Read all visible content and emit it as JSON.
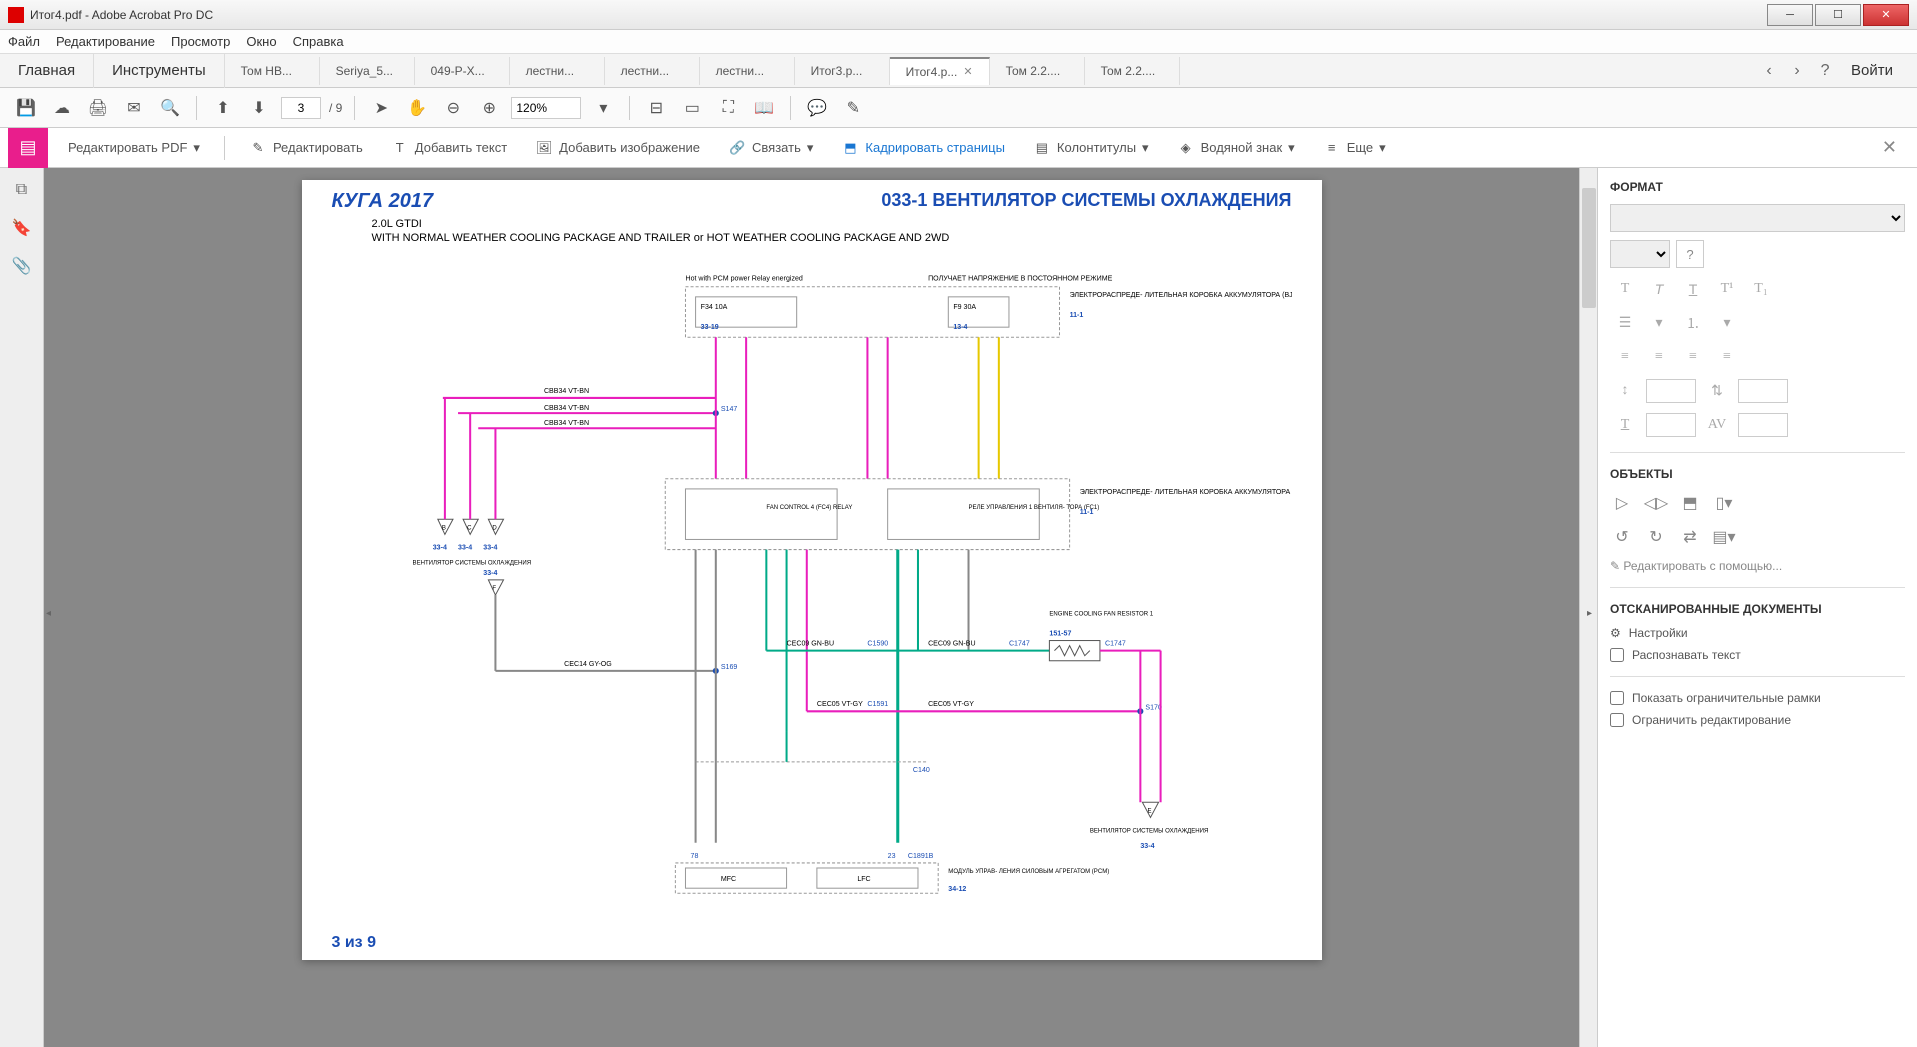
{
  "titlebar": {
    "text": "Итог4.pdf - Adobe Acrobat Pro DC"
  },
  "menu": {
    "items": [
      "Файл",
      "Редактирование",
      "Просмотр",
      "Окно",
      "Справка"
    ]
  },
  "nav": {
    "main": "Главная",
    "tools": "Инструменты",
    "login": "Войти"
  },
  "tabs": [
    {
      "label": "Том НВ..."
    },
    {
      "label": "Seriya_5..."
    },
    {
      "label": "049-Р-Х..."
    },
    {
      "label": "лестни..."
    },
    {
      "label": "лестни..."
    },
    {
      "label": "лестни..."
    },
    {
      "label": "Итог3.р..."
    },
    {
      "label": "Итог4.р...",
      "active": true
    },
    {
      "label": "Том 2.2...."
    },
    {
      "label": "Том 2.2...."
    }
  ],
  "toolbar": {
    "page_current": "3",
    "page_total": "/ 9",
    "zoom": "120%"
  },
  "editbar": {
    "title": "Редактировать PDF",
    "edit": "Редактировать",
    "add_text": "Добавить текст",
    "add_image": "Добавить изображение",
    "link": "Связать",
    "crop": "Кадрировать страницы",
    "headers": "Колонтитулы",
    "watermark": "Водяной знак",
    "more": "Еще"
  },
  "document": {
    "title_left": "КУГА 2017",
    "title_right": "033-1 ВЕНТИЛЯТОР СИСТЕМЫ ОХЛАЖДЕНИЯ",
    "sub1": "2.0L GTDI",
    "sub2": "WITH NORMAL WEATHER COOLING PACKAGE AND TRAILER or HOT WEATHER COOLING PACKAGE AND 2WD",
    "footer": "3 из 9",
    "labels": {
      "hot_pcm": "Hot with PCM power Relay energized",
      "voltage": "ПОЛУЧАЕТ НАПРЯЖЕНИЕ В ПОСТОЯННОМ РЕЖИМЕ",
      "bjb": "ЭЛЕКТРОРАСПРЕДЕ- ЛИТЕЛЬНАЯ КОРОБКА АККУМУЛЯТОРА (BJB)",
      "f34": "F34 10A",
      "f9": "F9 30A",
      "ref_33_19": "33-19",
      "ref_13_4": "13-4",
      "ref_11_1": "11-1",
      "fan_control": "FAN CONTROL 4 (FC4) RELAY",
      "fan_relay": "РЕЛЕ УПРАВЛЕНИЯ 1 ВЕНТИЛЯ- ТОРА (FC1)",
      "ref_151_57": "151-57",
      "resistor": "ENGINE COOLING FAN RESISTOR 1",
      "wire_cbb34": "CBB34   VT-BN",
      "cooling_fan": "ВЕНТИЛЯТОР СИСТЕМЫ ОХЛАЖДЕНИЯ",
      "ref_33_4": "33-4",
      "s147": "S147",
      "s169": "S169",
      "s170": "S170",
      "cec14": "CEC14   GY-OG",
      "cec09": "CEC09   GN-BU",
      "cec05": "CEC05   VT-GY",
      "c1590": "C1590",
      "c1591": "C1591",
      "c1747": "C1747",
      "c140": "C140",
      "c1891b": "C1891B",
      "mfc": "MFC",
      "lfc": "LFC",
      "pcm": "МОДУЛЬ УПРАВ- ЛЕНИЯ СИЛОВЫМ АГРЕГАТОМ (PCM)",
      "ref_34_12": "34-12",
      "pin78": "78",
      "pin23": "23"
    }
  },
  "rightpanel": {
    "format_title": "ФОРМАТ",
    "objects_title": "ОБЪЕКТЫ",
    "edit_with": "Редактировать с помощью...",
    "scanned_title": "ОТСКАНИРОВАННЫЕ ДОКУМЕНТЫ",
    "settings": "Настройки",
    "recognize": "Распознавать текст",
    "show_boxes": "Показать ограничительные рамки",
    "limit_edit": "Ограничить редактирование"
  }
}
